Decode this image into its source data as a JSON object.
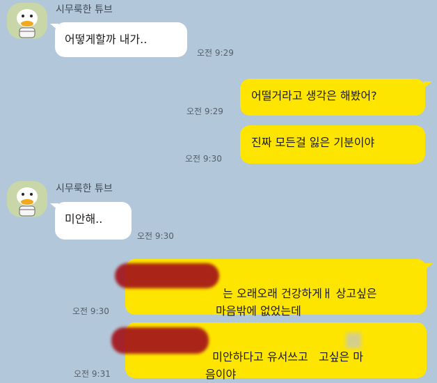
{
  "chat": {
    "sender_name": "시무룩한 튜브",
    "messages": [
      {
        "direction": "in",
        "text": "어떻게할까 내가..",
        "time": "오전 9:29"
      },
      {
        "direction": "out",
        "text": "어떨거라고 생각은 해봤어?",
        "time": "오전 9:29"
      },
      {
        "direction": "out",
        "text": "진짜 모든걸 잃은 기분이야",
        "time": "오전 9:30"
      },
      {
        "direction": "in",
        "text": "미안해..",
        "time": "오전 9:30"
      },
      {
        "direction": "out",
        "text": "는 오래오래 건강하게ㅐ 상고싶은\n마음밖에 없었는데",
        "time": "오전 9:30"
      },
      {
        "direction": "out",
        "text": "미안하다고 유서쓰고   고싶은 마\n음이야",
        "time": "오전 9:31"
      }
    ]
  },
  "colors": {
    "background": "#b2c7da",
    "incoming_bubble": "#ffffff",
    "outgoing_bubble": "#fee500",
    "redaction": "#a3151a"
  },
  "icons": {
    "avatar": "tube-duck-avatar-icon"
  }
}
